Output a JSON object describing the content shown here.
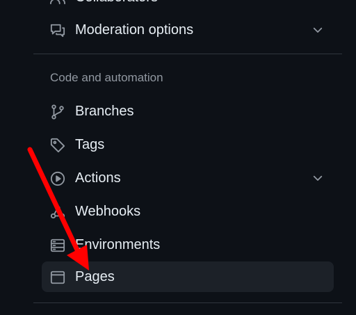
{
  "top_item": {
    "label": "Collaborators",
    "icon": "people-icon"
  },
  "moderation": {
    "label": "Moderation options",
    "icon": "comment-discussion-icon",
    "expandable": true
  },
  "section": {
    "heading": "Code and automation"
  },
  "items": [
    {
      "label": "Branches",
      "icon": "git-branch-icon"
    },
    {
      "label": "Tags",
      "icon": "tag-icon"
    },
    {
      "label": "Actions",
      "icon": "play-icon",
      "expandable": true
    },
    {
      "label": "Webhooks",
      "icon": "webhook-icon"
    },
    {
      "label": "Environments",
      "icon": "server-icon"
    },
    {
      "label": "Pages",
      "icon": "browser-icon",
      "active": true
    }
  ],
  "colors": {
    "background": "#0d1117",
    "text": "#e6edf3",
    "muted": "#9198a1",
    "active_bg": "#1c2128",
    "divider": "#30363d",
    "annotation_arrow": "#ff0000"
  }
}
